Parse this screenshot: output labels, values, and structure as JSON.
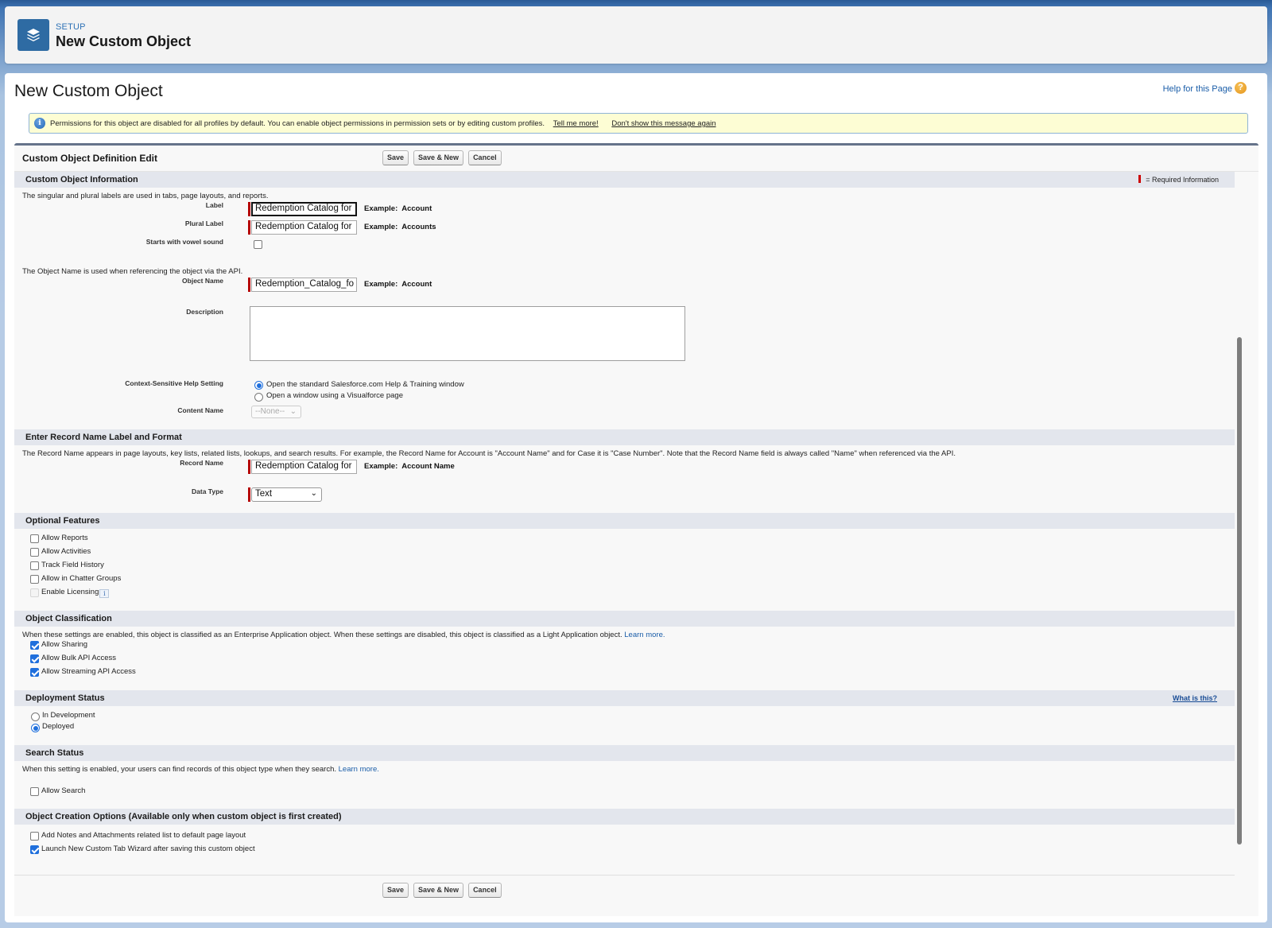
{
  "header": {
    "breadcrumb": "SETUP",
    "title": "New Custom Object",
    "icon": "layers-icon"
  },
  "page": {
    "title": "New Custom Object",
    "help_link": "Help for this Page",
    "help_icon": "?"
  },
  "info_message": {
    "icon": "i",
    "text": "Permissions for this object are disabled for all profiles by default. You can enable object permissions in permission sets or by editing custom profiles.",
    "link1": "Tell me more!",
    "link2": "Don't show this message again"
  },
  "form": {
    "title": "Custom Object Definition Edit",
    "buttons": {
      "save": "Save",
      "save_new": "Save & New",
      "cancel": "Cancel"
    },
    "required_legend": "= Required Information"
  },
  "sections": {
    "custom_object_info": {
      "title": "Custom Object Information",
      "desc1": "The singular and plural labels are used in tabs, page layouts, and reports.",
      "label": {
        "label": "Label",
        "value": "Redemption Catalog for",
        "example_prefix": "Example:",
        "example": "Account"
      },
      "plural_label": {
        "label": "Plural Label",
        "value": "Redemption Catalog for",
        "example_prefix": "Example:",
        "example": "Accounts"
      },
      "vowel": {
        "label": "Starts with vowel sound",
        "checked": false
      },
      "desc2": "The Object Name is used when referencing the object via the API.",
      "object_name": {
        "label": "Object Name",
        "value": "Redemption_Catalog_fo",
        "example_prefix": "Example:",
        "example": "Account"
      },
      "description": {
        "label": "Description",
        "value": ""
      },
      "help_setting": {
        "label": "Context-Sensitive Help Setting",
        "option1": "Open the standard Salesforce.com Help & Training window",
        "option2": "Open a window using a Visualforce page",
        "selected": "option1"
      },
      "content_name": {
        "label": "Content Name",
        "value": "--None--"
      }
    },
    "record_name": {
      "title": "Enter Record Name Label and Format",
      "desc": "The Record Name appears in page layouts, key lists, related lists, lookups, and search results. For example, the Record Name for Account is \"Account Name\" and for Case it is \"Case Number\". Note that the Record Name field is always called \"Name\" when referenced via the API.",
      "record_name": {
        "label": "Record Name",
        "value": "Redemption Catalog for",
        "example_prefix": "Example:",
        "example": "Account Name"
      },
      "data_type": {
        "label": "Data Type",
        "value": "Text"
      }
    },
    "optional_features": {
      "title": "Optional Features",
      "items": [
        {
          "label": "Allow Reports",
          "checked": false
        },
        {
          "label": "Allow Activities",
          "checked": false
        },
        {
          "label": "Track Field History",
          "checked": false
        },
        {
          "label": "Allow in Chatter Groups",
          "checked": false
        },
        {
          "label": "Enable Licensing",
          "checked": false,
          "disabled": true
        }
      ]
    },
    "classification": {
      "title": "Object Classification",
      "desc": "When these settings are enabled, this object is classified as an Enterprise Application object. When these settings are disabled, this object is classified as a Light Application object.",
      "learn_more": "Learn more.",
      "items": [
        {
          "label": "Allow Sharing",
          "checked": true
        },
        {
          "label": "Allow Bulk API Access",
          "checked": true
        },
        {
          "label": "Allow Streaming API Access",
          "checked": true
        }
      ]
    },
    "deployment": {
      "title": "Deployment Status",
      "what_is_this": "What is this?",
      "options": [
        "In Development",
        "Deployed"
      ],
      "selected": "Deployed"
    },
    "search": {
      "title": "Search Status",
      "desc": "When this setting is enabled, your users can find records of this object type when they search.",
      "learn_more": "Learn more.",
      "allow_search": {
        "label": "Allow Search",
        "checked": false
      }
    },
    "creation": {
      "title": "Object Creation Options (Available only when custom object is first created)",
      "items": [
        {
          "label": "Add Notes and Attachments related list to default page layout",
          "checked": false
        },
        {
          "label": "Launch New Custom Tab Wizard after saving this custom object",
          "checked": true
        }
      ]
    }
  }
}
